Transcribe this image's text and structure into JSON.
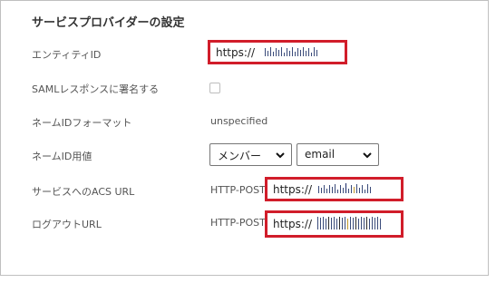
{
  "section": {
    "title": "サービスプロバイダーの設定"
  },
  "rows": {
    "entity_id": {
      "label": "エンティティID",
      "value": "https://"
    },
    "saml_sign": {
      "label": "SAMLレスポンスに署名する",
      "checked": false
    },
    "name_id_format": {
      "label": "ネームIDフォーマット",
      "value": "unspecified"
    },
    "name_id_values": {
      "label": "ネームID用値",
      "select_1": "メンバー",
      "select_2": "email"
    },
    "acs_url": {
      "label": "サービスへのACS URL",
      "method": "HTTP-POST",
      "value": "https://"
    },
    "logout_url": {
      "label": "ログアウトURL",
      "method": "HTTP-POST",
      "value": "https://"
    }
  },
  "colors": {
    "highlight_red": "#d11d2a",
    "panel_border": "#bfbfbf"
  },
  "icons": {
    "select_chevron": "chevron-down-icon"
  }
}
